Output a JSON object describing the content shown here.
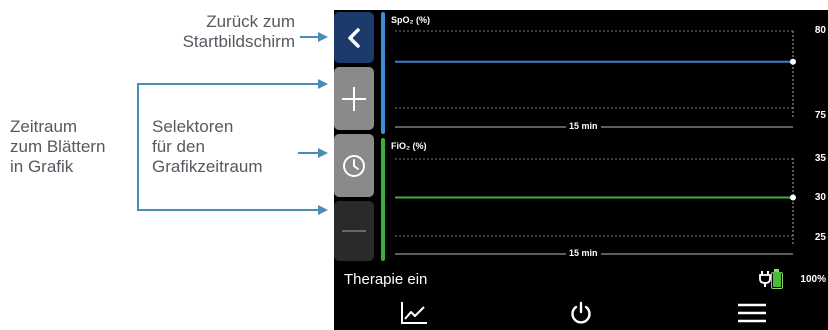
{
  "annotations": {
    "back": "Zurück zum Startbildschirm",
    "timespan": "Zeitraum zum Blättern in Grafik",
    "selectors": "Selektoren für den Grafikzeitraum"
  },
  "annotations_lines": {
    "back": [
      "Zurück zum",
      "Startbildschirm"
    ],
    "timespan": [
      "Zeitraum",
      "zum Blättern",
      "in Grafik"
    ],
    "selectors": [
      "Selektoren",
      "für den",
      "Grafikzeitraum"
    ]
  },
  "side_buttons": [
    {
      "name": "back",
      "icon": "chevron-left-icon"
    },
    {
      "name": "plus",
      "icon": "plus-icon"
    },
    {
      "name": "clock",
      "icon": "clock-icon"
    },
    {
      "name": "minus",
      "icon": "minus-icon"
    }
  ],
  "graphs": {
    "spo2": {
      "label": "SpO₂ (%)",
      "accent": "#3a8fd8",
      "trace": "#3a7fd0",
      "y_ticks": [
        "80",
        "75"
      ],
      "y_range": [
        75,
        80
      ],
      "value": 78,
      "time_label": "15 min"
    },
    "fio2": {
      "label": "FiO₂ (%)",
      "accent": "#3fae3a",
      "trace": "#3fae3a",
      "y_ticks": [
        "35",
        "30",
        "25"
      ],
      "y_range": [
        25,
        35
      ],
      "value": 30,
      "time_label": "15 min"
    }
  },
  "status": {
    "text": "Therapie ein",
    "battery_pct": "100%",
    "battery_level": 1.0,
    "plug_icon": "plug-icon",
    "battery_icon": "battery-icon"
  },
  "nav": [
    {
      "name": "trend",
      "icon": "trend-chart-icon"
    },
    {
      "name": "power",
      "icon": "power-icon"
    },
    {
      "name": "menu",
      "icon": "hamburger-menu-icon"
    }
  ],
  "colors": {
    "arrow": "#4a8fb3",
    "back_button": "#1c3a6b",
    "selected_button": "#8a8a8a"
  }
}
